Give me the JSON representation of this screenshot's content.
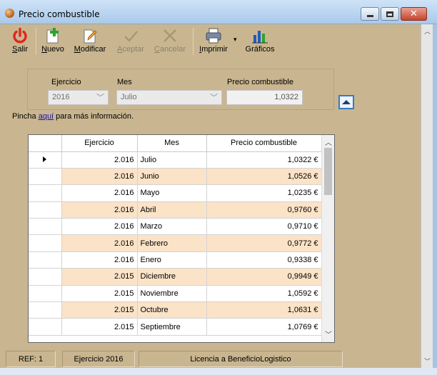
{
  "window": {
    "title": "Precio combustible"
  },
  "toolbar": {
    "salir": "Salir",
    "nuevo": "Nuevo",
    "modificar": "Modificar",
    "aceptar": "Aceptar",
    "cancelar": "Cancelar",
    "imprimir": "Imprimir",
    "graficos": "Gráficos"
  },
  "filter": {
    "ejercicio_label": "Ejercicio",
    "mes_label": "Mes",
    "precio_label": "Precio combustible",
    "ejercicio_value": "2016",
    "mes_value": "Julio",
    "precio_value": "1,0322"
  },
  "info": {
    "prefix": "Pincha ",
    "link": "aquí",
    "suffix": " para más información."
  },
  "grid": {
    "headers": [
      "Ejercicio",
      "Mes",
      "Precio combustible"
    ],
    "rows": [
      {
        "ejercicio": "2.016",
        "mes": "Julio",
        "precio": "1,0322 €"
      },
      {
        "ejercicio": "2.016",
        "mes": "Junio",
        "precio": "1,0526 €"
      },
      {
        "ejercicio": "2.016",
        "mes": "Mayo",
        "precio": "1,0235 €"
      },
      {
        "ejercicio": "2.016",
        "mes": "Abril",
        "precio": "0,9760 €"
      },
      {
        "ejercicio": "2.016",
        "mes": "Marzo",
        "precio": "0,9710 €"
      },
      {
        "ejercicio": "2.016",
        "mes": "Febrero",
        "precio": "0,9772 €"
      },
      {
        "ejercicio": "2.016",
        "mes": "Enero",
        "precio": "0,9338 €"
      },
      {
        "ejercicio": "2.015",
        "mes": "Diciembre",
        "precio": "0,9949 €"
      },
      {
        "ejercicio": "2.015",
        "mes": "Noviembre",
        "precio": "1,0592 €"
      },
      {
        "ejercicio": "2.015",
        "mes": "Octubre",
        "precio": "1,0631 €"
      },
      {
        "ejercicio": "2.015",
        "mes": "Septiembre",
        "precio": "1,0769 €"
      }
    ]
  },
  "status": {
    "ref": "REF: 1",
    "ejercicio": "Ejercicio  2016",
    "licencia": "Licencia a BeneficioLogistico"
  },
  "colors": {
    "background": "#c9b690",
    "alt_row": "#fbe3c7",
    "link": "#1a0dab"
  }
}
